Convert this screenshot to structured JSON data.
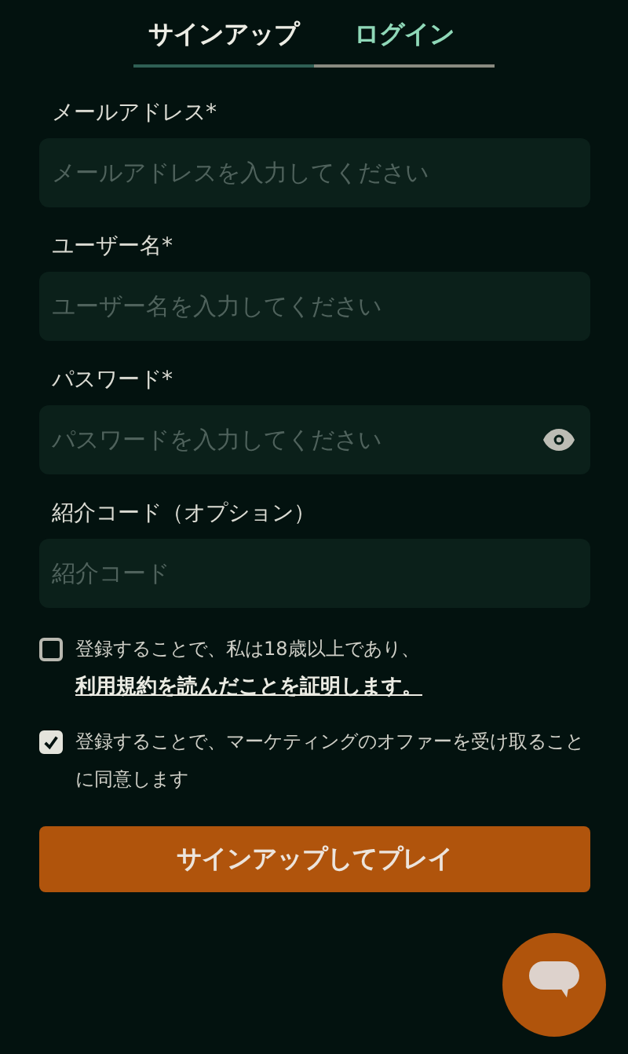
{
  "tabs": [
    {
      "label": "サインアップ",
      "selected": true
    },
    {
      "label": "ログイン",
      "selected": false
    }
  ],
  "fields": [
    {
      "label": "メールアドレス*",
      "placeholder": "メールアドレスを入力してください",
      "kind": "text"
    },
    {
      "label": "ユーザー名*",
      "placeholder": "ユーザー名を入力してください",
      "kind": "text"
    },
    {
      "label": "パスワード*",
      "placeholder": "パスワードを入力してください",
      "kind": "password"
    },
    {
      "label": "紹介コード（オプション）",
      "placeholder": "紹介コード",
      "kind": "text"
    }
  ],
  "consents": [
    {
      "text": "登録することで、私は18歳以上であり、",
      "link": "利用規約を読んだことを証明します。",
      "checked": false
    },
    {
      "text": "登録することで、マーケティングのオファーを受け取ることに同意します",
      "checked": true
    }
  ],
  "submit": "サインアップしてプレイ"
}
